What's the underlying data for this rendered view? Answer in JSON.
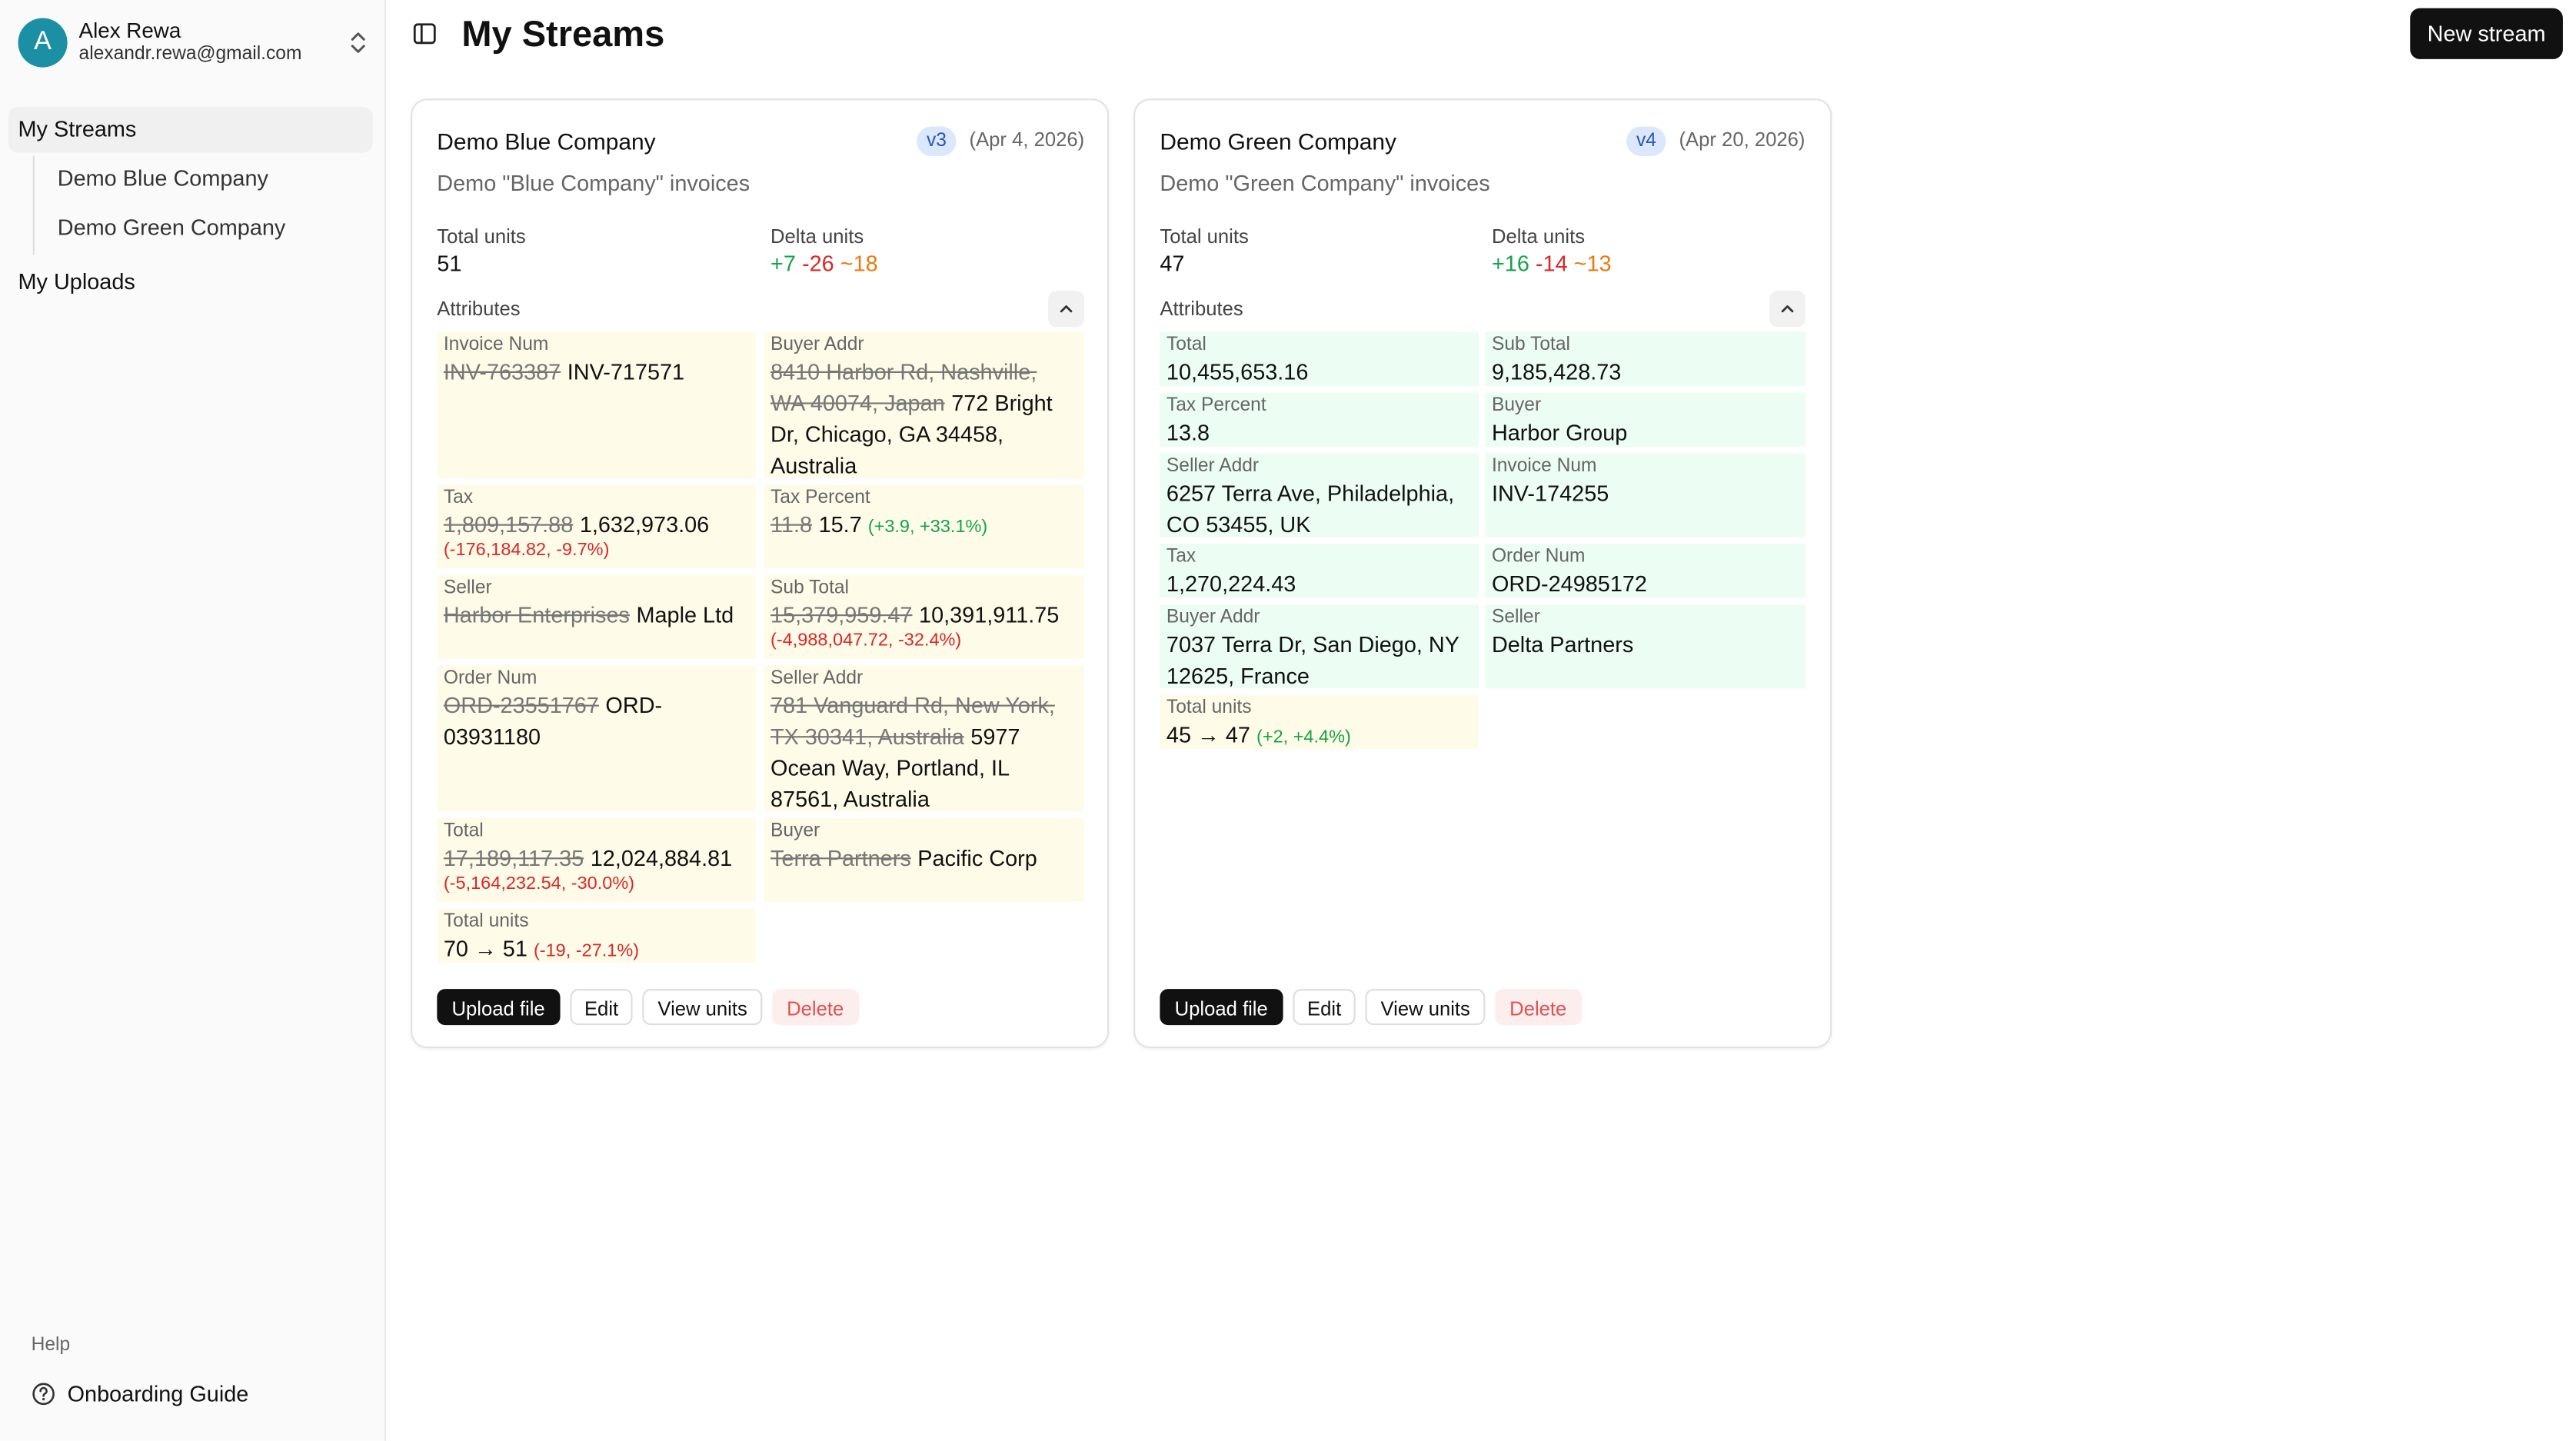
{
  "user": {
    "initial": "A",
    "name": "Alex Rewa",
    "email": "alexandr.rewa@gmail.com"
  },
  "sidebar": {
    "streams_label": "My Streams",
    "sub_items": [
      "Demo Blue Company",
      "Demo Green Company"
    ],
    "uploads_label": "My Uploads",
    "help_label": "Help",
    "guide_label": "Onboarding Guide"
  },
  "header": {
    "title": "My Streams",
    "new_stream": "New stream"
  },
  "cards": [
    {
      "title": "Demo Blue Company",
      "version": "v3",
      "date": "(Apr 4, 2026)",
      "desc": "Demo \"Blue Company\" invoices",
      "total_units_label": "Total units",
      "total_units": "51",
      "delta_label": "Delta units",
      "delta_plus": "+7",
      "delta_minus": "-26",
      "delta_tilde": "~18",
      "attributes_label": "Attributes",
      "attrs": [
        {
          "label": "Invoice Num",
          "old": "INV-763387",
          "new": "INV-717571",
          "change": ""
        },
        {
          "label": "Buyer Addr",
          "old": "8410 Harbor Rd, Nashville, WA 40074, Japan",
          "new": "772 Bright Dr, Chicago, GA 34458, Australia",
          "change": ""
        },
        {
          "label": "Tax",
          "old": "1,809,157.88",
          "new": "1,632,973.06",
          "change": "(-176,184.82, -9.7%)"
        },
        {
          "label": "Tax Percent",
          "old": "11.8",
          "new": "15.7",
          "change": "(+3.9, +33.1%)"
        },
        {
          "label": "Seller",
          "old": "Harbor Enterprises",
          "new": "Maple Ltd",
          "change": ""
        },
        {
          "label": "Sub Total",
          "old": "15,379,959.47",
          "new": "10,391,911.75",
          "change": "(-4,988,047.72, -32.4%)"
        },
        {
          "label": "Order Num",
          "old": "ORD-23551767",
          "new": "ORD-03931180",
          "change": ""
        },
        {
          "label": "Seller Addr",
          "old": "781 Vanguard Rd, New York, TX 30341, Australia",
          "new": "5977 Ocean Way, Portland, IL 87561, Australia",
          "change": ""
        },
        {
          "label": "Total",
          "old": "17,189,117.35",
          "new": "12,024,884.81",
          "change": "(-5,164,232.54, -30.0%)"
        },
        {
          "label": "Buyer",
          "old": "Terra Partners",
          "new": "Pacific Corp",
          "change": ""
        },
        {
          "label": "Total units",
          "old": "",
          "new": "70 → 51",
          "change": "(-19, -27.1%)"
        }
      ],
      "actions": {
        "upload": "Upload file",
        "edit": "Edit",
        "view": "View units",
        "delete": "Delete"
      }
    },
    {
      "title": "Demo Green Company",
      "version": "v4",
      "date": "(Apr 20, 2026)",
      "desc": "Demo \"Green Company\" invoices",
      "total_units_label": "Total units",
      "total_units": "47",
      "delta_label": "Delta units",
      "delta_plus": "+16",
      "delta_minus": "-14",
      "delta_tilde": "~13",
      "attributes_label": "Attributes",
      "attrs": [
        {
          "label": "Total",
          "old": "",
          "new": "10,455,653.16",
          "change": ""
        },
        {
          "label": "Sub Total",
          "old": "",
          "new": "9,185,428.73",
          "change": ""
        },
        {
          "label": "Tax Percent",
          "old": "",
          "new": "13.8",
          "change": ""
        },
        {
          "label": "Buyer",
          "old": "",
          "new": "Harbor Group",
          "change": ""
        },
        {
          "label": "Seller Addr",
          "old": "",
          "new": "6257 Terra Ave, Philadelphia, CO 53455, UK",
          "change": ""
        },
        {
          "label": "Invoice Num",
          "old": "",
          "new": "INV-174255",
          "change": ""
        },
        {
          "label": "Tax",
          "old": "",
          "new": "1,270,224.43",
          "change": ""
        },
        {
          "label": "Order Num",
          "old": "",
          "new": "ORD-24985172",
          "change": ""
        },
        {
          "label": "Buyer Addr",
          "old": "",
          "new": "7037 Terra Dr, San Diego, NY 12625, France",
          "change": ""
        },
        {
          "label": "Seller",
          "old": "",
          "new": "Delta Partners",
          "change": ""
        },
        {
          "label": "Total units",
          "old": "",
          "new": "45 → 47",
          "change": "(+2, +4.4%)"
        }
      ],
      "actions": {
        "upload": "Upload file",
        "edit": "Edit",
        "view": "View units",
        "delete": "Delete"
      }
    }
  ]
}
